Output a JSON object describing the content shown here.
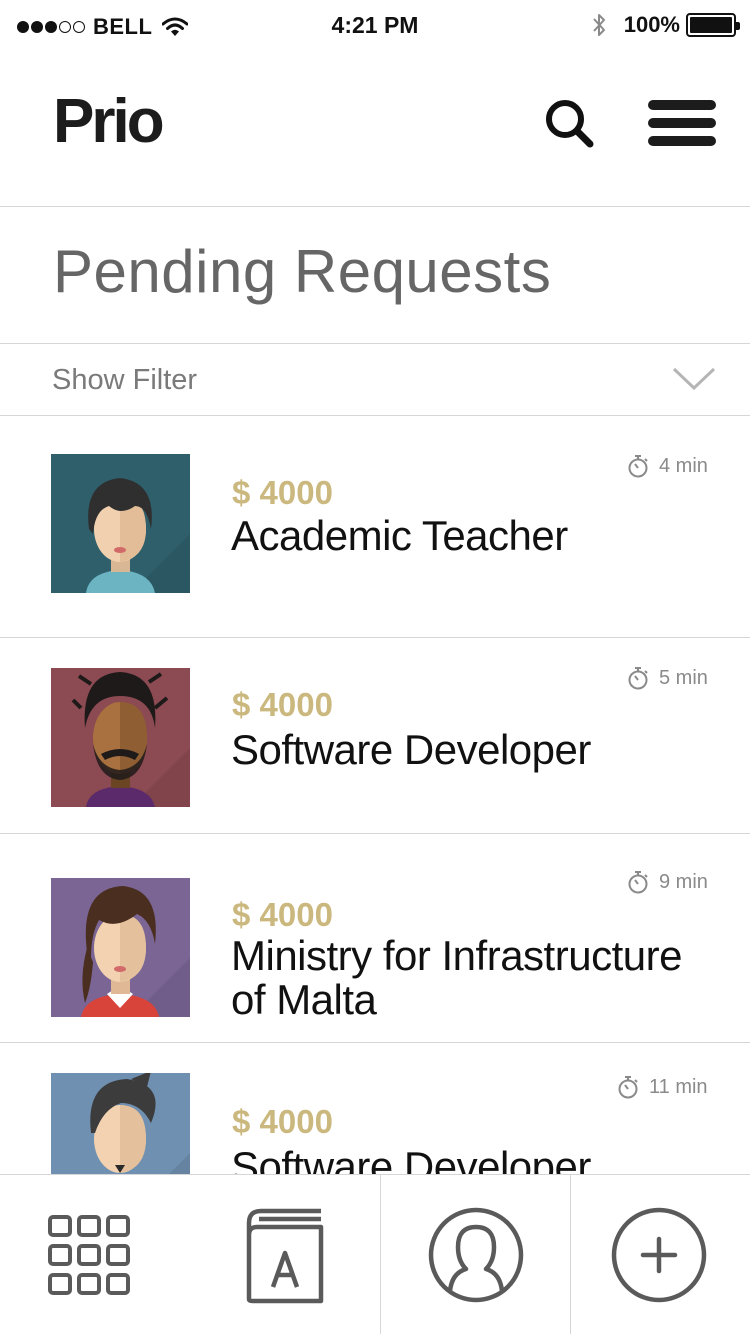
{
  "status_bar": {
    "carrier": "BELL",
    "time": "4:21 PM",
    "battery": "100%",
    "battery_level": 1.0,
    "signal_strength": 3,
    "signal_max": 5
  },
  "header": {
    "logo": "Prio",
    "icons": [
      "search-icon",
      "hamburger-menu-icon"
    ]
  },
  "page": {
    "title": "Pending Requests"
  },
  "filter": {
    "label": "Show Filter",
    "icon": "chevron-down-icon"
  },
  "requests": [
    {
      "price": "$ 4000",
      "title": "Academic Teacher",
      "time": "4 min",
      "avatar_bg": "#2e5f6b"
    },
    {
      "price": "$ 4000",
      "title": "Software Developer",
      "time": "5 min",
      "avatar_bg": "#8c4a52"
    },
    {
      "price": "$ 4000",
      "title_line1": "Ministry for Infrastructure",
      "title_line2": "of Malta",
      "time": "9 min",
      "avatar_bg": "#7a6595"
    },
    {
      "price": "$ 4000",
      "title": "Software Developer",
      "time": "11 min",
      "avatar_bg": "#6f90b0"
    }
  ],
  "tab_bar": {
    "icons": [
      "grid-icon",
      "dictionary-icon",
      "profile-icon",
      "add-icon"
    ]
  },
  "colors": {
    "price": "#cbb87e",
    "text_dark": "#111111",
    "text_grey": "#666666",
    "divider": "#d6d6d6",
    "icon_grey": "#5a5a5a"
  }
}
